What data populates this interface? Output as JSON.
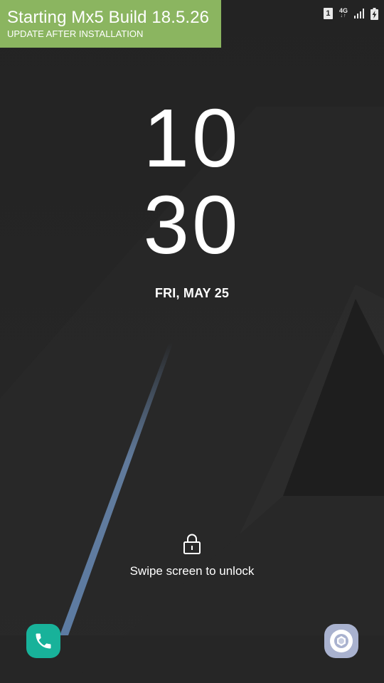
{
  "banner": {
    "title": "Starting Mx5 Build 18.5.26",
    "subtitle": "UPDATE AFTER INSTALLATION",
    "color": "#8bb560"
  },
  "status_bar": {
    "sim_slot": "1",
    "network_type": "4G",
    "icons": [
      "sim-card-icon",
      "data-arrows-icon",
      "signal-icon",
      "battery-charging-icon"
    ]
  },
  "lockscreen": {
    "hour": "10",
    "minute": "30",
    "date": "FRI, MAY 25",
    "unlock_hint": "Swipe screen to unlock",
    "lock_icon": "padlock-icon"
  },
  "shortcuts": {
    "left": {
      "icon": "phone-icon",
      "color": "#18b29a"
    },
    "right": {
      "icon": "camera-icon",
      "color": "#a9b2cf"
    }
  }
}
